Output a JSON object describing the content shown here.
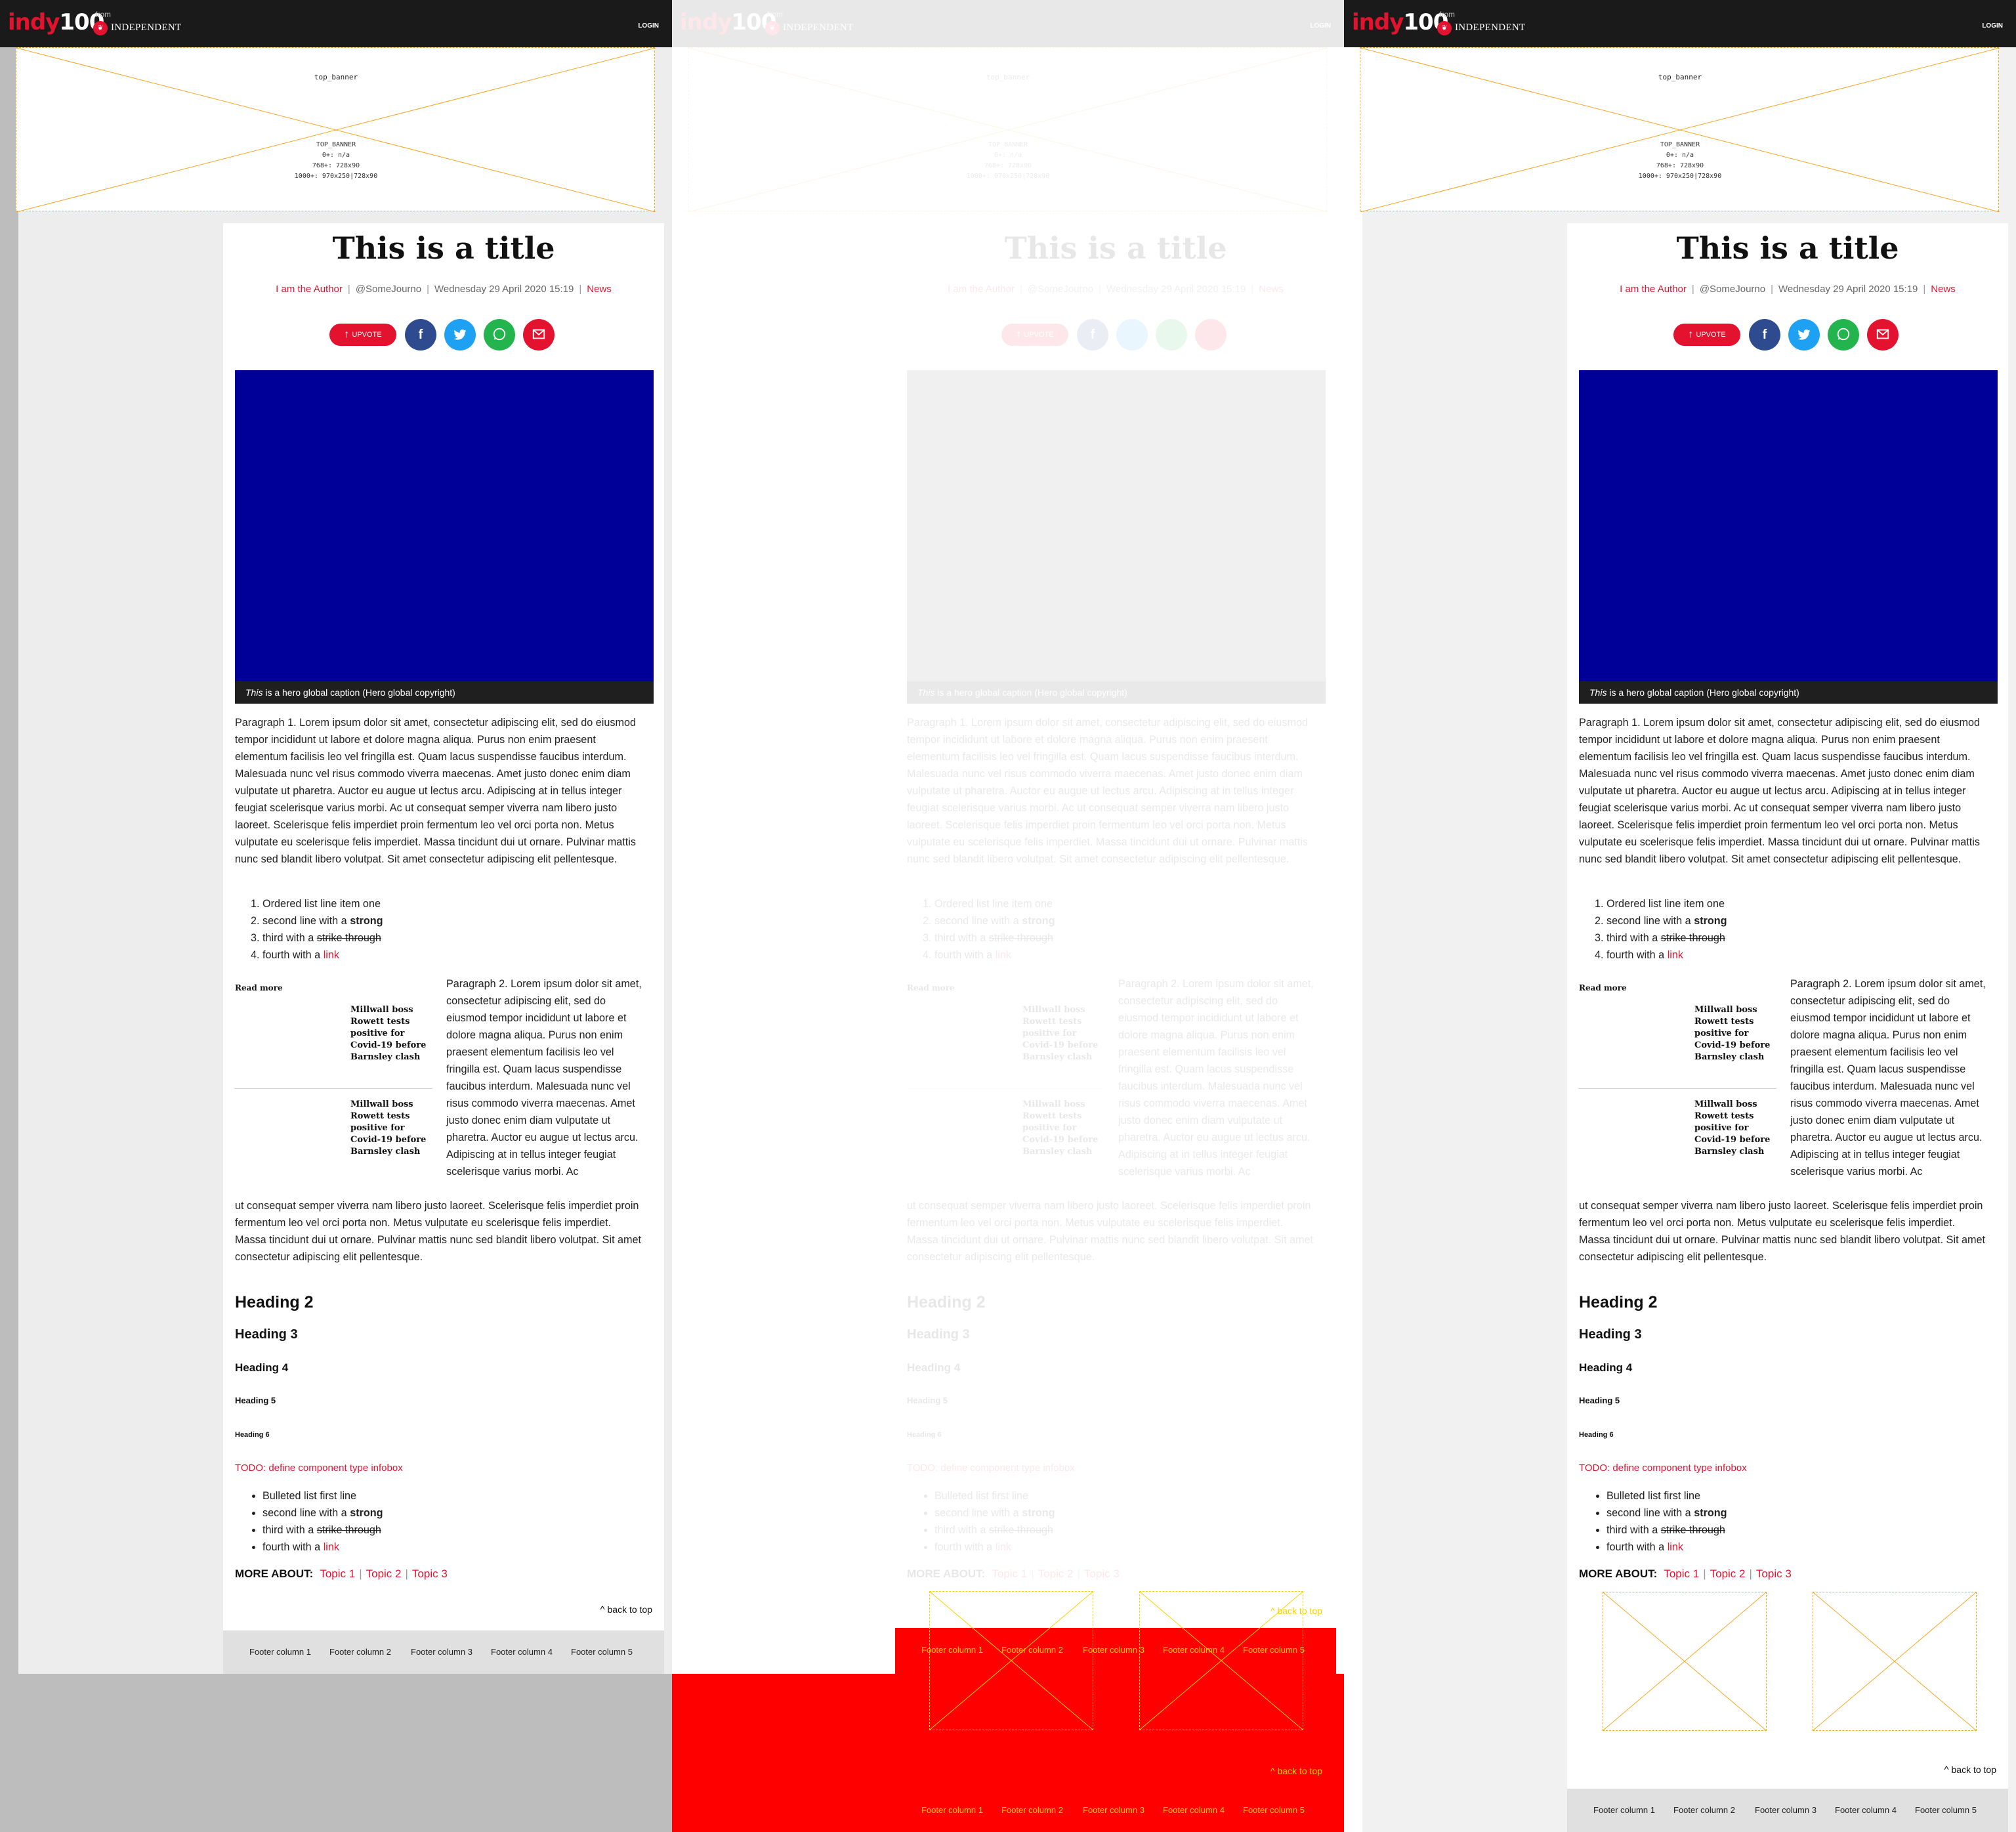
{
  "header": {
    "logo_part1": "indy",
    "logo_part2": "100",
    "from": "from",
    "publisher_badge": "❦",
    "publisher": "INDEPENDENT",
    "login": "LOGIN"
  },
  "ad_banner": {
    "slot_name": "top_banner",
    "info_lines": [
      "TOP_BANNER",
      "0+: n/a",
      "768+: 728x90",
      "1000+: 970x250|728x90"
    ]
  },
  "article": {
    "title": "This is a title",
    "author": "I am the Author",
    "handle": "@SomeJourno",
    "date": "Wednesday 29 April 2020 15:19",
    "section": "News",
    "separator": "|",
    "upvote_label": "UPVOTE",
    "share_icons": [
      "facebook-icon",
      "twitter-icon",
      "whatsapp-icon",
      "email-icon"
    ],
    "hero_color": "#000099",
    "caption_em": "This",
    "caption_rest": " is a hero global caption (Hero global copyright)",
    "paragraph1": "Paragraph 1. Lorem ipsum dolor sit amet, consectetur adipiscing elit, sed do eiusmod tempor incididunt ut labore et dolore magna aliqua. Purus non enim praesent elementum facilisis leo vel fringilla est. Quam lacus suspendisse faucibus interdum. Malesuada nunc vel risus commodo viverra maecenas. Amet justo donec enim diam vulputate ut pharetra. Auctor eu augue ut lectus arcu. Adipiscing at in tellus integer feugiat scelerisque varius morbi. Ac ut consequat semper viverra nam libero justo laoreet. Scelerisque felis imperdiet proin fermentum leo vel orci porta non. Metus vulputate eu scelerisque felis imperdiet. Massa tincidunt dui ut ornare. Pulvinar mattis nunc sed blandit libero volutpat. Sit amet consectetur adipiscing elit pellentesque.",
    "ordered_list": {
      "item1": "Ordered list line item one",
      "item2_text": "second line with a ",
      "item2_strong": "strong",
      "item3_text": "third with a ",
      "item3_strike": "strike through",
      "item4_text": "fourth with a ",
      "item4_link": "link"
    },
    "read_more": {
      "title": "Read more",
      "items": [
        "Millwall boss Rowett tests positive for Covid-19 before Barnsley clash",
        "Millwall boss Rowett tests positive for Covid-19 before Barnsley clash"
      ]
    },
    "paragraph2_top": "Paragraph 2. Lorem ipsum dolor sit amet, consectetur adipiscing elit, sed do eiusmod tempor incididunt ut labore et dolore magna aliqua. Purus non enim praesent elementum facilisis leo vel fringilla est. Quam lacus suspendisse faucibus interdum. Malesuada nunc vel risus commodo viverra maecenas. Amet justo donec enim diam vulputate ut pharetra. Auctor eu augue ut lectus arcu. Adipiscing at in tellus integer feugiat scelerisque varius morbi. Ac",
    "paragraph2_bottom": "ut consequat semper viverra nam libero justo laoreet. Scelerisque felis imperdiet proin fermentum leo vel orci porta non. Metus vulputate eu scelerisque felis imperdiet. Massa tincidunt dui ut ornare. Pulvinar mattis nunc sed blandit libero volutpat. Sit amet consectetur adipiscing elit pellentesque.",
    "heading2": "Heading 2",
    "heading3": "Heading 3",
    "heading4": "Heading 4",
    "heading5": "Heading 5",
    "heading6": "Heading 6",
    "todo": "TODO: define component type infobox",
    "bullet_list": {
      "item1": "Bulleted list first line",
      "item2_text": "second line with a ",
      "item2_strong": "strong",
      "item3_text": "third with a ",
      "item3_strike": "strike through",
      "item4_text": "fourth with a ",
      "item4_link": "link"
    },
    "more_about_label": "MORE ABOUT:",
    "topics": [
      "Topic 1",
      "Topic 2",
      "Topic 3"
    ],
    "back_to_top": "back to top"
  },
  "footer": {
    "columns": [
      "Footer column 1",
      "Footer column 2",
      "Footer column 3",
      "Footer column 4",
      "Footer column 5"
    ]
  },
  "colors": {
    "brand_red": "#e3132f",
    "header_bg": "#1a1a1a",
    "hero_blue": "#000099",
    "ad_outline": "#f5a623",
    "debug_red": "#ff0000"
  }
}
